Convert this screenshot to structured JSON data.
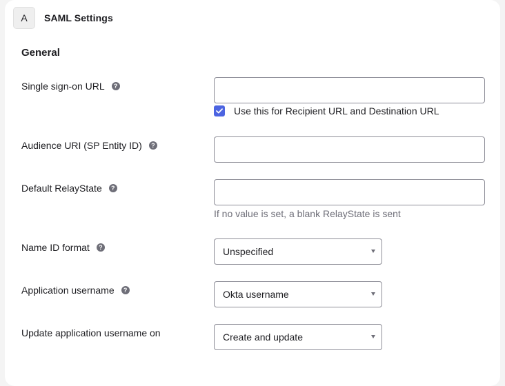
{
  "header": {
    "step_letter": "A",
    "title": "SAML Settings"
  },
  "section": {
    "title": "General"
  },
  "fields": {
    "sso_url": {
      "label": "Single sign-on URL",
      "value": "",
      "checkbox_label": "Use this for Recipient URL and Destination URL",
      "checkbox_checked": true
    },
    "audience_uri": {
      "label": "Audience URI (SP Entity ID)",
      "value": ""
    },
    "relay_state": {
      "label": "Default RelayState",
      "value": "",
      "hint": "If no value is set, a blank RelayState is sent"
    },
    "name_id_format": {
      "label": "Name ID format",
      "selected": "Unspecified"
    },
    "app_username": {
      "label": "Application username",
      "selected": "Okta username"
    },
    "update_username_on": {
      "label": "Update application username on",
      "selected": "Create and update"
    }
  },
  "icons": {
    "help": "question-circle-icon",
    "check": "checkmark-icon",
    "dropdown": "caret-down-icon"
  },
  "colors": {
    "accent": "#4c64e1",
    "help_icon": "#6e6e78",
    "hint_text": "#6e6e78",
    "border": "#8c8c96"
  }
}
